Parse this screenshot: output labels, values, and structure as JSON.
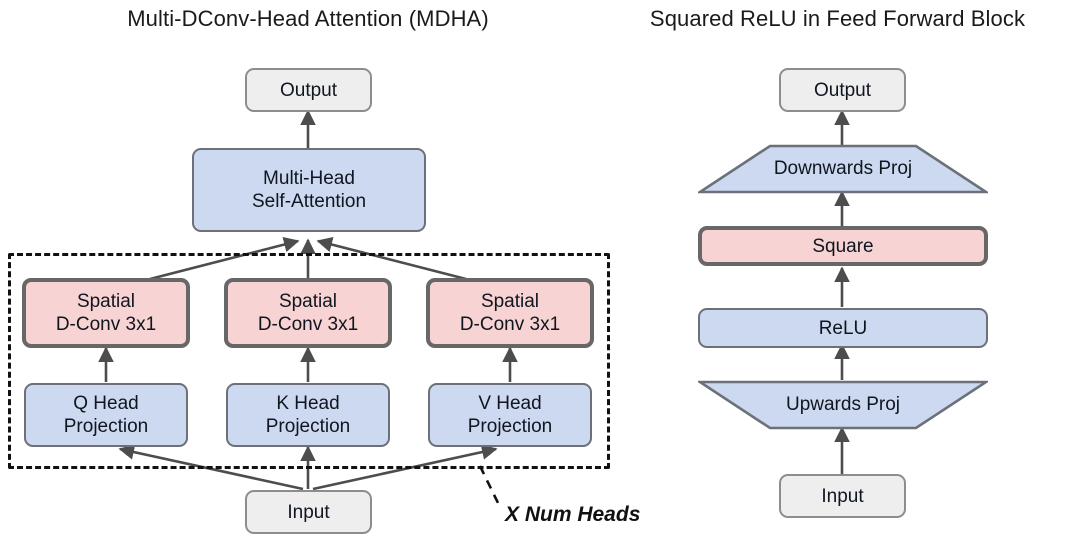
{
  "titles": {
    "left": "Multi-DConv-Head Attention (MDHA)",
    "right": "Squared ReLU in Feed Forward Block"
  },
  "colors": {
    "gray_fill": "#eeeeee",
    "gray_border": "#8d8d8d",
    "blue_fill": "#ccd9f0",
    "blue_border": "#6b7079",
    "pink_fill": "#f7d3d3",
    "pink_border": "#676767",
    "arrow": "#4d4d4d",
    "dashed_border": "#111111",
    "text": "#10161f"
  },
  "left_diagram": {
    "name": "Multi-DConv-Head Attention (MDHA)",
    "output_label": "Output",
    "attention_label": "Multi-Head\nSelf-Attention",
    "input_label": "Input",
    "annotation": "X Num Heads",
    "heads": [
      {
        "conv_label": "Spatial\nD-Conv 3x1",
        "proj_label": "Q Head\nProjection"
      },
      {
        "conv_label": "Spatial\nD-Conv 3x1",
        "proj_label": "K Head\nProjection"
      },
      {
        "conv_label": "Spatial\nD-Conv 3x1",
        "proj_label": "V Head\nProjection"
      }
    ]
  },
  "right_diagram": {
    "name": "Squared ReLU in Feed Forward Block",
    "output_label": "Output",
    "downwards_proj_label": "Downwards Proj",
    "square_label": "Square",
    "relu_label": "ReLU",
    "upwards_proj_label": "Upwards Proj",
    "input_label": "Input"
  },
  "chart_data": {
    "type": "diagram",
    "title": "Multi-DConv-Head Attention (MDHA) and Squared ReLU in Feed Forward Block",
    "panels": [
      {
        "title": "Multi-DConv-Head Attention (MDHA)",
        "nodes": [
          {
            "id": "output",
            "label": "Output",
            "style": "gray"
          },
          {
            "id": "mhsa",
            "label": "Multi-Head Self-Attention",
            "style": "blue"
          },
          {
            "id": "dconv_q",
            "label": "Spatial D-Conv 3x1",
            "style": "pink"
          },
          {
            "id": "dconv_k",
            "label": "Spatial D-Conv 3x1",
            "style": "pink"
          },
          {
            "id": "dconv_v",
            "label": "Spatial D-Conv 3x1",
            "style": "pink"
          },
          {
            "id": "q_proj",
            "label": "Q Head Projection",
            "style": "blue"
          },
          {
            "id": "k_proj",
            "label": "K Head Projection",
            "style": "blue"
          },
          {
            "id": "v_proj",
            "label": "V Head Projection",
            "style": "blue"
          },
          {
            "id": "input",
            "label": "Input",
            "style": "gray"
          }
        ],
        "edges": [
          [
            "input",
            "q_proj"
          ],
          [
            "input",
            "k_proj"
          ],
          [
            "input",
            "v_proj"
          ],
          [
            "q_proj",
            "dconv_q"
          ],
          [
            "k_proj",
            "dconv_k"
          ],
          [
            "v_proj",
            "dconv_v"
          ],
          [
            "dconv_q",
            "mhsa"
          ],
          [
            "dconv_k",
            "mhsa"
          ],
          [
            "dconv_v",
            "mhsa"
          ],
          [
            "mhsa",
            "output"
          ]
        ],
        "group": {
          "label": "X Num Heads",
          "members": [
            "dconv_q",
            "dconv_k",
            "dconv_v",
            "q_proj",
            "k_proj",
            "v_proj"
          ]
        }
      },
      {
        "title": "Squared ReLU in Feed Forward Block",
        "nodes": [
          {
            "id": "output",
            "label": "Output",
            "style": "gray"
          },
          {
            "id": "down_proj",
            "label": "Downwards Proj",
            "style": "blue-trapezoid"
          },
          {
            "id": "square",
            "label": "Square",
            "style": "pink"
          },
          {
            "id": "relu",
            "label": "ReLU",
            "style": "blue"
          },
          {
            "id": "up_proj",
            "label": "Upwards Proj",
            "style": "blue-trapezoid"
          },
          {
            "id": "input",
            "label": "Input",
            "style": "gray"
          }
        ],
        "edges": [
          [
            "input",
            "up_proj"
          ],
          [
            "up_proj",
            "relu"
          ],
          [
            "relu",
            "square"
          ],
          [
            "square",
            "down_proj"
          ],
          [
            "down_proj",
            "output"
          ]
        ]
      }
    ]
  }
}
